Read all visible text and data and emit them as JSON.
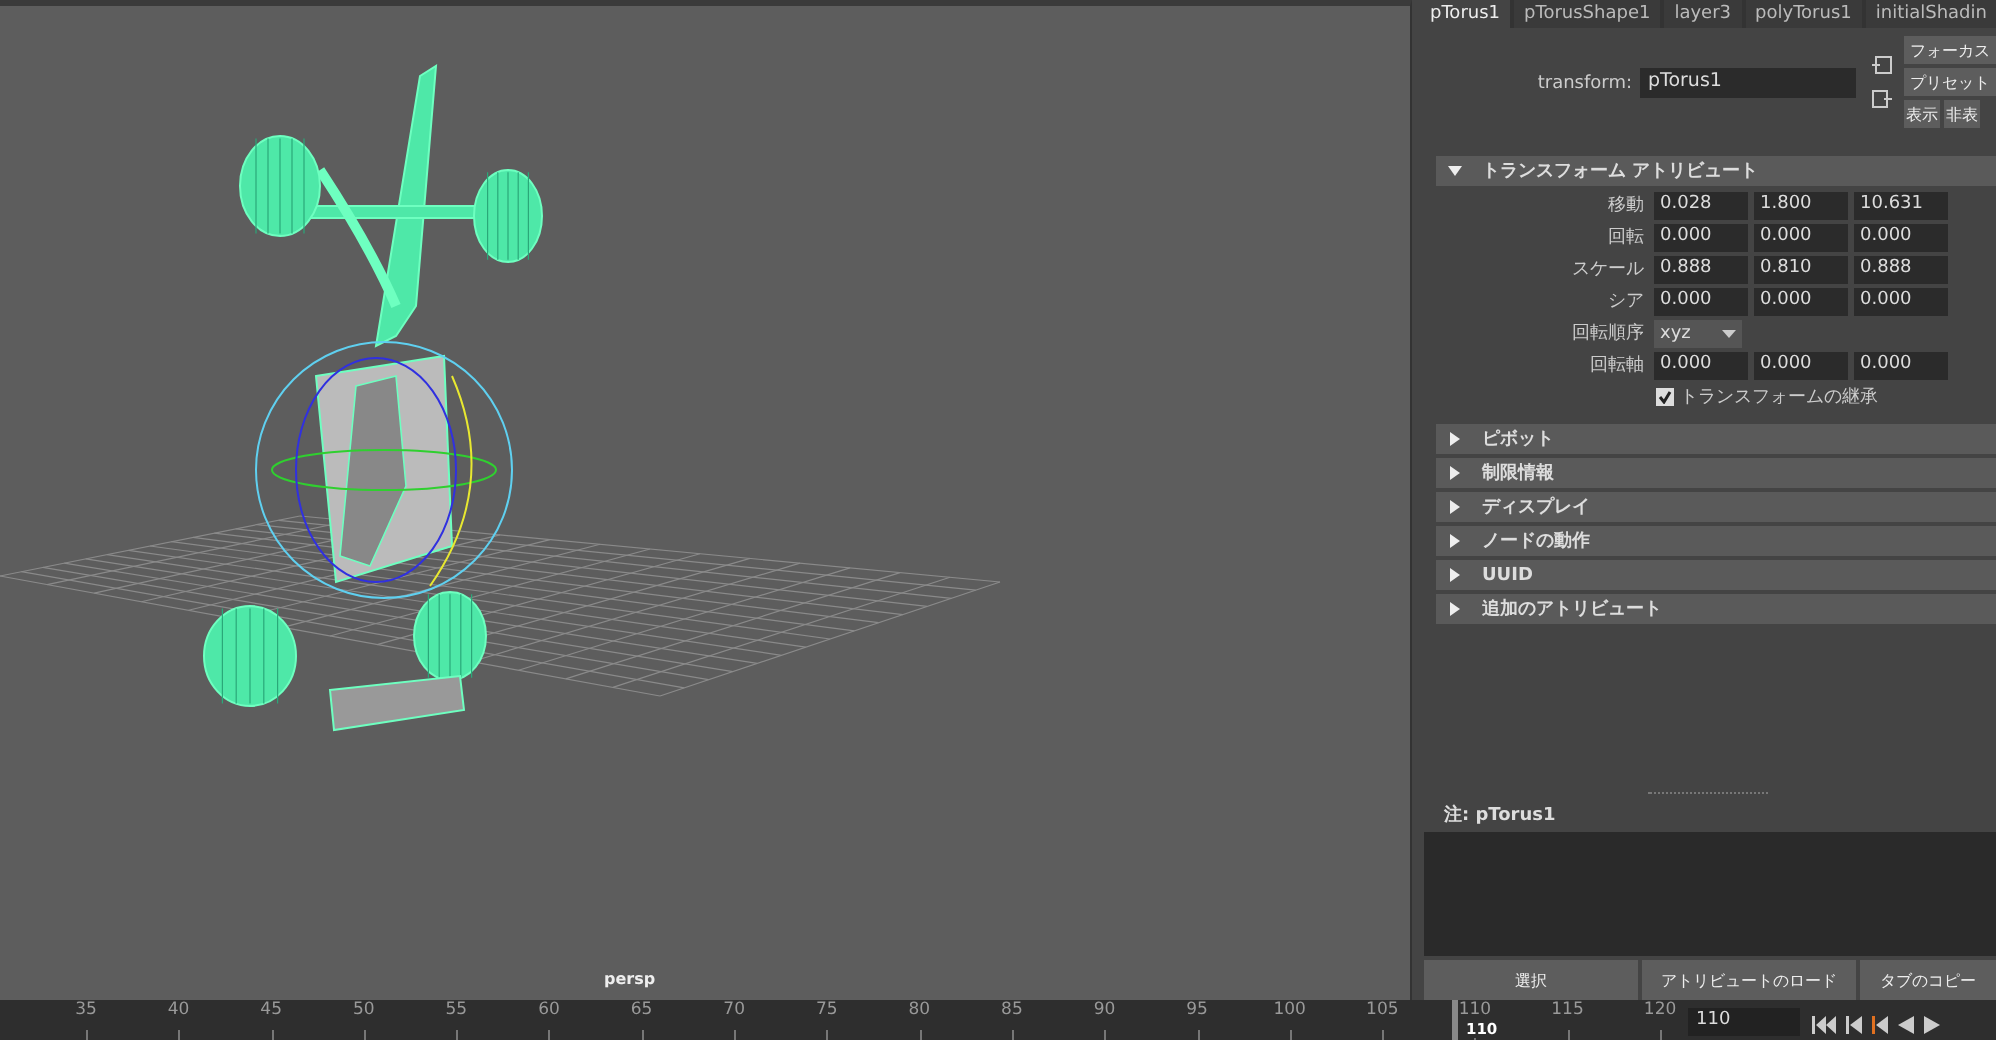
{
  "viewport": {
    "camera": "persp"
  },
  "attribute_editor": {
    "tabs": [
      {
        "label": "pTorus1",
        "selected": true
      },
      {
        "label": "pTorusShape1",
        "selected": false
      },
      {
        "label": "layer3",
        "selected": false
      },
      {
        "label": "polyTorus1",
        "selected": false
      },
      {
        "label": "initialShadin",
        "selected": false
      }
    ],
    "node_type_label": "transform:",
    "node_name": "pTorus1",
    "side_buttons": [
      "フォーカス",
      "プリセット",
      "表示",
      "非表"
    ],
    "sections": [
      {
        "title": "トランスフォーム アトリビュート",
        "expanded": true,
        "rows": [
          {
            "kind": "vector",
            "label": "移動",
            "values": [
              "0.028",
              "1.800",
              "10.631"
            ]
          },
          {
            "kind": "vector",
            "label": "回転",
            "values": [
              "0.000",
              "0.000",
              "0.000"
            ]
          },
          {
            "kind": "vector",
            "label": "スケール",
            "values": [
              "0.888",
              "0.810",
              "0.888"
            ]
          },
          {
            "kind": "vector",
            "label": "シア",
            "values": [
              "0.000",
              "0.000",
              "0.000"
            ]
          },
          {
            "kind": "enum",
            "label": "回転順序",
            "value": "xyz"
          },
          {
            "kind": "vector",
            "label": "回転軸",
            "values": [
              "0.000",
              "0.000",
              "0.000"
            ]
          },
          {
            "kind": "checkbox",
            "label": "トランスフォームの継承",
            "checked": true
          }
        ]
      },
      {
        "title": "ピボット",
        "expanded": false
      },
      {
        "title": "制限情報",
        "expanded": false
      },
      {
        "title": "ディスプレイ",
        "expanded": false
      },
      {
        "title": "ノードの動作",
        "expanded": false
      },
      {
        "title": "UUID",
        "expanded": false
      },
      {
        "title": "追加のアトリビュート",
        "expanded": false
      }
    ],
    "notes_label": "注: pTorus1",
    "bottom_buttons": [
      "選択",
      "アトリビュートのロード",
      "タブのコピー"
    ]
  },
  "timeline": {
    "ticks": [
      "35",
      "40",
      "45",
      "50",
      "55",
      "60",
      "65",
      "70",
      "75",
      "80",
      "85",
      "90",
      "95",
      "100",
      "105",
      "110",
      "115",
      "120"
    ],
    "current_frame": "110",
    "frame_field": "110"
  }
}
